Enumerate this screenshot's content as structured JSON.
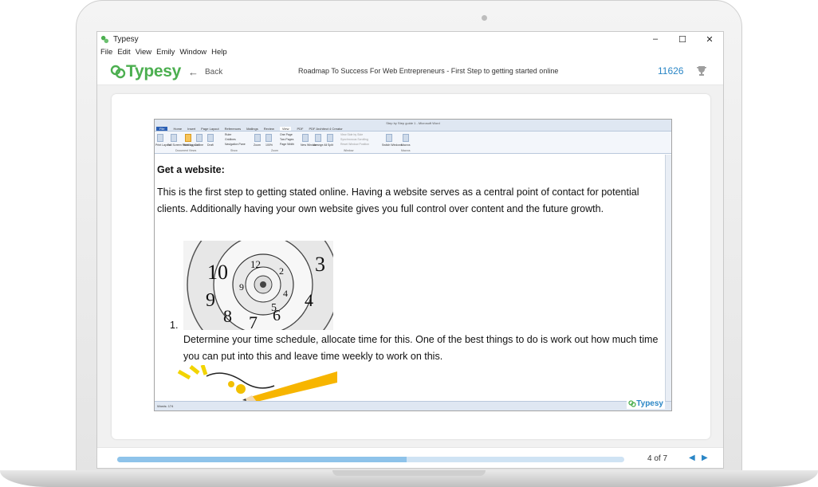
{
  "window": {
    "title": "Typesy",
    "minimize": "–",
    "maximize": "☐",
    "close": "✕"
  },
  "menu": [
    "File",
    "Edit",
    "View",
    "Emily",
    "Window",
    "Help"
  ],
  "header": {
    "logo": "Typesy",
    "back_label": "Back",
    "document_title": "Roadmap To Success For Web Entrepreneurs - First Step to getting started online",
    "counter": "11626"
  },
  "word": {
    "title": "Step by Step guide 1 - Microsoft Word",
    "tabs": [
      "File",
      "Home",
      "Insert",
      "Page Layout",
      "References",
      "Mailings",
      "Review",
      "View",
      "PDF",
      "PDF Architect 4 Creator"
    ],
    "ribbon_buttons": [
      "Print Layout",
      "Full Screen Reading",
      "Web Layout",
      "Outline",
      "Draft",
      "Ruler",
      "Gridlines",
      "Navigation Pane",
      "Zoom",
      "100%",
      "One Page",
      "Two Pages",
      "Page Width",
      "New Window",
      "Arrange All",
      "Split",
      "View Side by Side",
      "Synchronous Scrolling",
      "Reset Window Position",
      "Switch Windows",
      "Macros"
    ],
    "ribbon_groups": [
      "Document Views",
      "Show",
      "Zoom",
      "Window",
      "Macros"
    ],
    "status": "Words: 174",
    "heading": "Get a website:",
    "paragraph": "This is the first step to getting stated online.  Having a website serves as a central point of contact for potential clients.  Additionally having your own website gives you full control over content and the future growth.",
    "list_number": "1.",
    "list_item": "Determine your time schedule, allocate time for this.  One of the best things to do is work out how much time you can put into this and leave time weekly to work on this.",
    "watermark": "Typesy"
  },
  "footer": {
    "page_indicator": "4 of 7",
    "prev": "◀",
    "next": "▶",
    "progress": 0.57
  },
  "colors": {
    "brand_green": "#4caf50",
    "accent_blue": "#2a86c6",
    "progress_track": "#cfe3f4",
    "progress_fill": "#8ec3ea"
  }
}
